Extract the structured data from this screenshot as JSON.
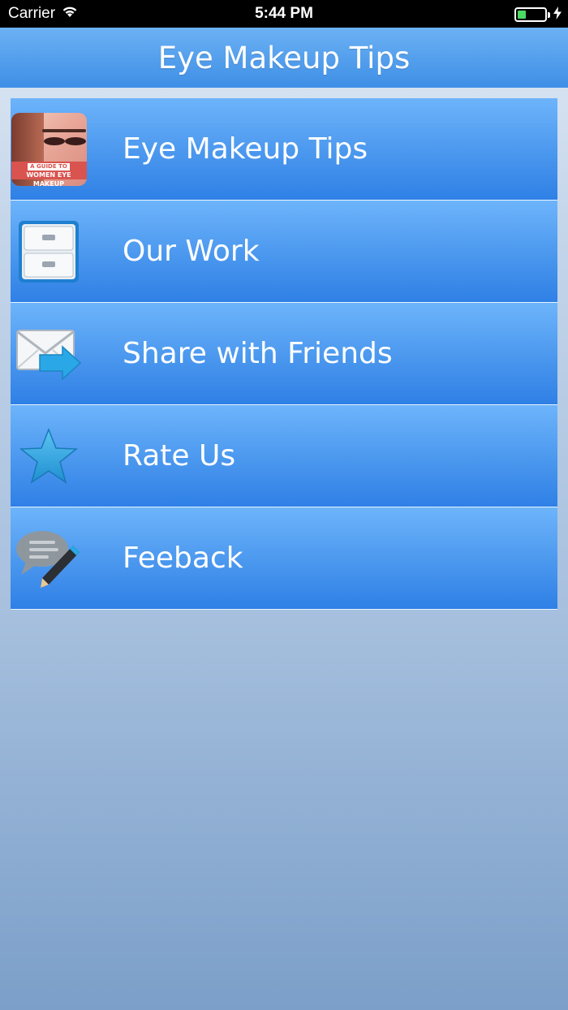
{
  "status_bar": {
    "carrier": "Carrier",
    "time": "5:44 PM",
    "battery_level": 0.3,
    "battery_color": "#4cd964",
    "icons": [
      "wifi-icon",
      "battery-icon",
      "charging-bolt-icon"
    ]
  },
  "nav": {
    "title": "Eye Makeup Tips"
  },
  "menu": {
    "items": [
      {
        "label": "Eye Makeup Tips",
        "icon": "app-thumbnail-icon",
        "thumbnail_text_top": "A GUIDE TO",
        "thumbnail_text_bottom": "WOMEN EYE MAKEUP"
      },
      {
        "label": "Our Work",
        "icon": "drawer-cabinet-icon"
      },
      {
        "label": "Share with Friends",
        "icon": "mail-share-icon"
      },
      {
        "label": "Rate Us",
        "icon": "star-icon"
      },
      {
        "label": "Feeback",
        "icon": "feedback-chat-pencil-icon"
      }
    ]
  },
  "colors": {
    "nav_top": "#6cb1f4",
    "nav_bottom": "#3e8fe6",
    "row_top": "#6db4fb",
    "row_bottom": "#2f80e6"
  }
}
